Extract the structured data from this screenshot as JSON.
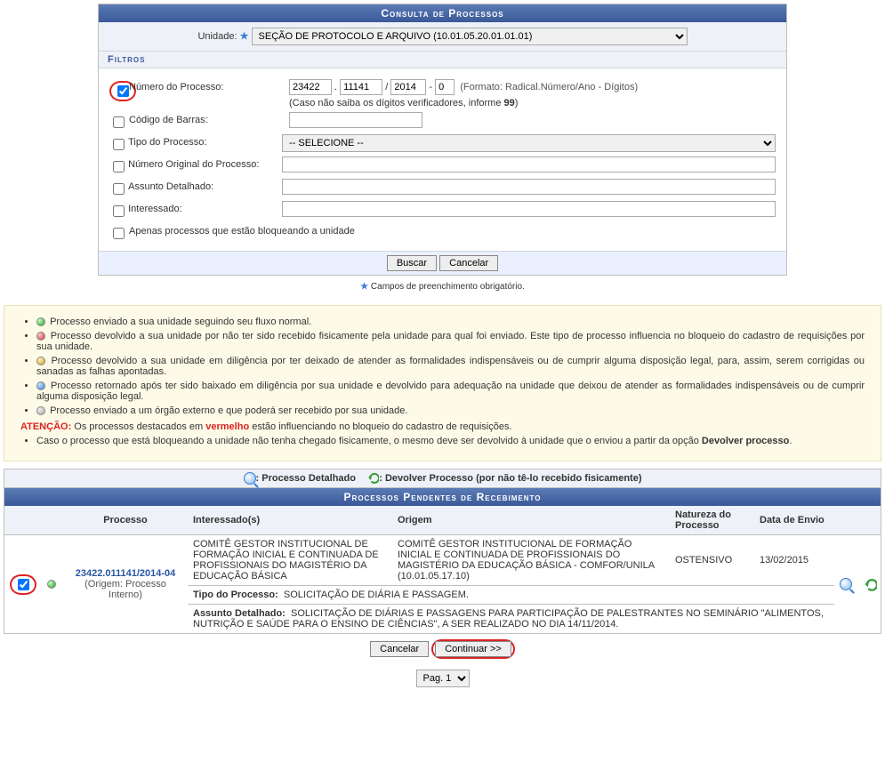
{
  "panel": {
    "title": "Consulta de Processos",
    "unidade_label": "Unidade:",
    "unidade_value": "SEÇÃO DE PROTOCOLO E ARQUIVO (10.01.05.20.01.01.01)",
    "filtros_label": "Filtros"
  },
  "filters": {
    "numero_label": "Número do Processo:",
    "numero": {
      "radical": "23422",
      "numero": "11141",
      "ano": "2014",
      "digitos": "0"
    },
    "numero_format": "(Formato: Radical.Número/Ano - Dígitos)",
    "numero_hint_pre": "(Caso não saiba os dígitos verificadores, informe ",
    "numero_hint_bold": "99",
    "numero_hint_post": ")",
    "codigo_label": "Código de Barras:",
    "tipo_label": "Tipo do Processo:",
    "tipo_value": "-- SELECIONE --",
    "numero_original_label": "Número Original do Processo:",
    "assunto_label": "Assunto Detalhado:",
    "interessado_label": "Interessado:",
    "bloqueando_label": "Apenas processos que estão bloqueando a unidade",
    "buscar_label": "Buscar",
    "cancelar_label": "Cancelar",
    "required_note": "Campos de preenchimento obrigatório."
  },
  "legend": {
    "green": "Processo enviado a sua unidade seguindo seu fluxo normal.",
    "red": "Processo devolvido a sua unidade por não ter sido recebido fisicamente pela unidade para qual foi enviado. Este tipo de processo influencia no bloqueio do cadastro de requisições por sua unidade.",
    "yellow": "Processo devolvido a sua unidade em diligência por ter deixado de atender as formalidades indispensáveis ou de cumprir alguma disposição legal, para, assim, serem corrigidas ou sanadas as falhas apontadas.",
    "blue": "Processo retornado após ter sido baixado em diligência por sua unidade e devolvido para adequação na unidade que deixou de atender as formalidades indispensáveis ou de cumprir alguma disposição legal.",
    "grey": "Processo enviado a um órgão externo e que poderá ser recebido por sua unidade.",
    "atencao_label": "ATENÇÃO:",
    "atencao_pre": " Os processos destacados em ",
    "atencao_word": "vermelho",
    "atencao_post": " estão influenciando no bloqueio do cadastro de requisições.",
    "bullet2_pre": "Caso o processo que está bloqueando a unidade não tenha chegado fisicamente, o mesmo deve ser devolvido à unidade que o enviou a partir da opção ",
    "bullet2_bold": "Devolver processo",
    "bullet2_post": "."
  },
  "iconbar": {
    "detalhado": ": Processo Detalhado",
    "devolver": ": Devolver Processo (por não tê-lo recebido fisicamente)"
  },
  "table": {
    "title": "Processos Pendentes de Recebimento",
    "cols": {
      "processo": "Processo",
      "interessado": "Interessado(s)",
      "origem": "Origem",
      "natureza": "Natureza do Processo",
      "data": "Data de Envio"
    },
    "row": {
      "numero": "23422.011141/2014-04",
      "origem_small": "(Origem: Processo Interno)",
      "interessado": "COMITÊ GESTOR INSTITUCIONAL DE FORMAÇÃO INICIAL E CONTINUADA DE PROFISSIONAIS DO MAGISTÉRIO DA EDUCAÇÃO BÁSICA",
      "origem": "COMITÊ GESTOR INSTITUCIONAL DE FORMAÇÃO INICIAL E CONTINUADA DE PROFISSIONAIS DO MAGISTÉRIO DA EDUCAÇÃO BÁSICA - COMFOR/UNILA (10.01.05.17.10)",
      "natureza": "OSTENSIVO",
      "data": "13/02/2015",
      "tipo_label": "Tipo do Processo:",
      "tipo_value": "SOLICITAÇÃO DE DIÁRIA E PASSAGEM.",
      "assunto_label": "Assunto Detalhado:",
      "assunto_value": "SOLICITAÇÃO DE DIÁRIAS E PASSAGENS PARA PARTICIPAÇÃO DE PALESTRANTES NO SEMINÁRIO \"ALIMENTOS, NUTRIÇÃO E SAÚDE PARA O ENSINO DE CIÊNCIAS\", A SER REALIZADO NO DIA 14/11/2014."
    }
  },
  "footer": {
    "cancelar": "Cancelar",
    "continuar": "Continuar >>",
    "pag_label": "Pag. 1"
  }
}
